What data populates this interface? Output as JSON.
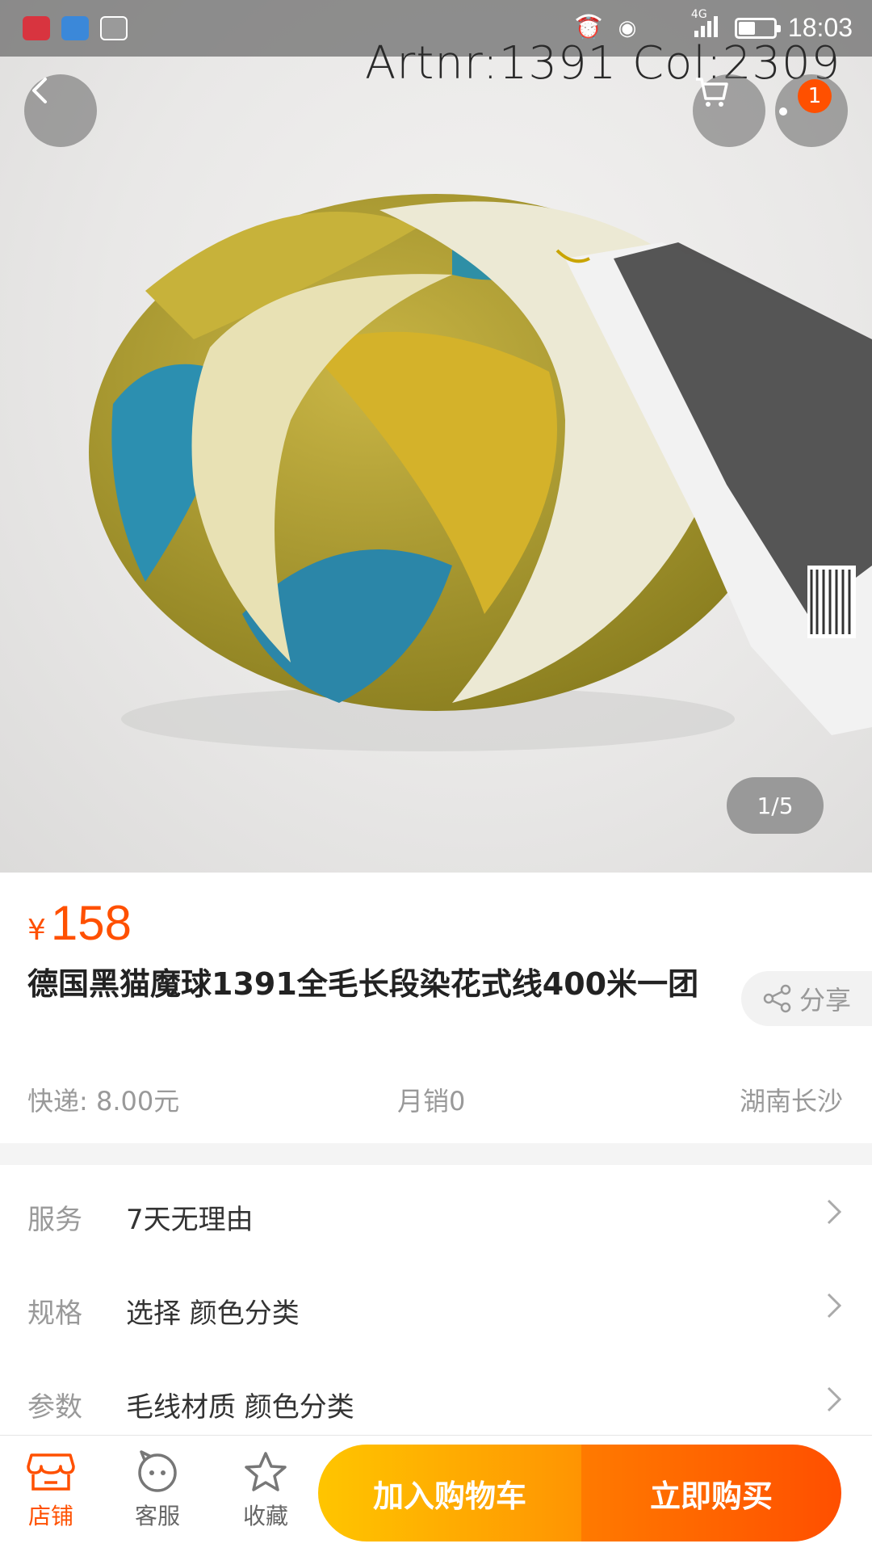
{
  "status_bar": {
    "time": "18:03",
    "network": "4G",
    "icons": [
      "app-red-book-icon",
      "app-blue-icon",
      "app-shield-icon",
      "alarm-icon",
      "eye-icon",
      "wifi-icon",
      "signal-icon",
      "battery-icon"
    ]
  },
  "hero": {
    "overlay_text": "Artnr:1391  Col:2309",
    "cart_badge_count": "1",
    "pager": "1/5"
  },
  "product": {
    "currency": "¥",
    "price": "158",
    "title": "德国黑猫魔球1391全毛长段染花式线400米一团",
    "share_label": "分享",
    "shipping": "快递: 8.00元",
    "monthly_sales": "月销0",
    "location": "湖南长沙"
  },
  "specs": [
    {
      "key": "服务",
      "value": "7天无理由"
    },
    {
      "key": "规格",
      "value": "选择 颜色分类"
    },
    {
      "key": "参数",
      "value": "毛线材质 颜色分类"
    }
  ],
  "bottom_bar": {
    "store_label": "店铺",
    "service_label": "客服",
    "favorite_label": "收藏",
    "add_to_cart_label": "加入购物车",
    "buy_now_label": "立即购买"
  },
  "colors": {
    "accent": "#ff5000",
    "cart_gradient": [
      "#ffc500",
      "#ff9402"
    ],
    "buy_gradient": [
      "#ff7a00",
      "#ff4f00"
    ]
  }
}
